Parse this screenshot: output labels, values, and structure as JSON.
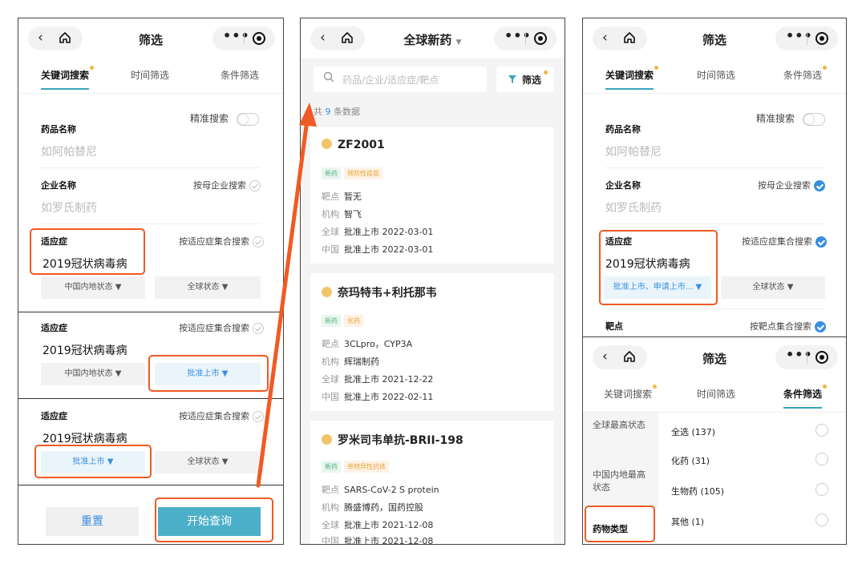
{
  "nav_icons": {
    "back": "chevron-left-icon",
    "home": "home-icon",
    "more": "more-dots-icon",
    "record": "record-icon"
  },
  "phone1": {
    "title": "筛选",
    "tabs": [
      "关键词搜索",
      "时间筛选",
      "条件筛选"
    ],
    "precise_search": "精准搜索",
    "drug_name_label": "药品名称",
    "drug_name_placeholder": "如阿帕替尼",
    "company_label": "企业名称",
    "company_placeholder": "如罗氏制药",
    "by_parent_company": "按母企业搜索",
    "indication_label": "适应症",
    "indication_value": "2019冠状病毒病",
    "by_indication_set": "按适应症集合搜索",
    "china_status": "中国内地状态",
    "global_status": "全球状态",
    "approved": "批准上市",
    "reset": "重置",
    "start_query": "开始查询"
  },
  "phone2": {
    "title": "全球新药",
    "search_placeholder": "药品/企业/适应症/靶点",
    "filter_label": "筛选",
    "count_prefix": "共",
    "count_value": "9",
    "count_suffix": "条数据",
    "keys": {
      "target": "靶点",
      "org": "机构",
      "global": "全球",
      "china": "中国"
    },
    "cards": [
      {
        "name": "ZF2001",
        "tags": [
          "新药",
          "预防性疫苗"
        ],
        "target": "暂无",
        "org": "智飞",
        "global": "批准上市 2022-03-01",
        "china": "批准上市 2022-03-01"
      },
      {
        "name": "奈玛特韦+利托那韦",
        "tags": [
          "新药",
          "化药"
        ],
        "target": "3CLpro，CYP3A",
        "org": "辉瑞制药",
        "global": "批准上市 2021-12-22",
        "china": "批准上市 2022-02-11"
      },
      {
        "name": "罗米司韦单抗-BRII-198",
        "tags": [
          "新药",
          "单特异性抗体"
        ],
        "target": "SARS-CoV-2 S protein",
        "org": "腾盛博药，国药控股",
        "global": "批准上市 2021-12-08",
        "china": "批准上市 2021-12-08"
      }
    ]
  },
  "phone3": {
    "title": "筛选",
    "tabs": [
      "关键词搜索",
      "时间筛选",
      "条件筛选"
    ],
    "precise_search": "精准搜索",
    "drug_name_label": "药品名称",
    "drug_name_placeholder": "如阿帕替尼",
    "company_label": "企业名称",
    "company_placeholder": "如罗氏制药",
    "by_parent_company": "按母企业搜索",
    "indication_label": "适应症",
    "indication_value": "2019冠状病毒病",
    "by_indication_set": "按适应症集合搜索",
    "china_status_selected": "批准上市、申请上市...",
    "global_status": "全球状态",
    "target_label": "靶点",
    "by_target_set": "按靶点集合搜索"
  },
  "phone4": {
    "title": "筛选",
    "tabs": [
      "关键词搜索",
      "时间筛选",
      "条件筛选"
    ],
    "side": [
      "全球最高状态",
      "中国内地最高状态",
      "药物类型"
    ],
    "options": [
      "全选 (137)",
      "化药 (31)",
      "生物药 (105)",
      "其他 (1)"
    ]
  },
  "colors": {
    "accent": "#3ba4ba",
    "highlight": "#f05a24",
    "query_button": "#4bafc7",
    "link_blue": "#3a8fe0"
  }
}
